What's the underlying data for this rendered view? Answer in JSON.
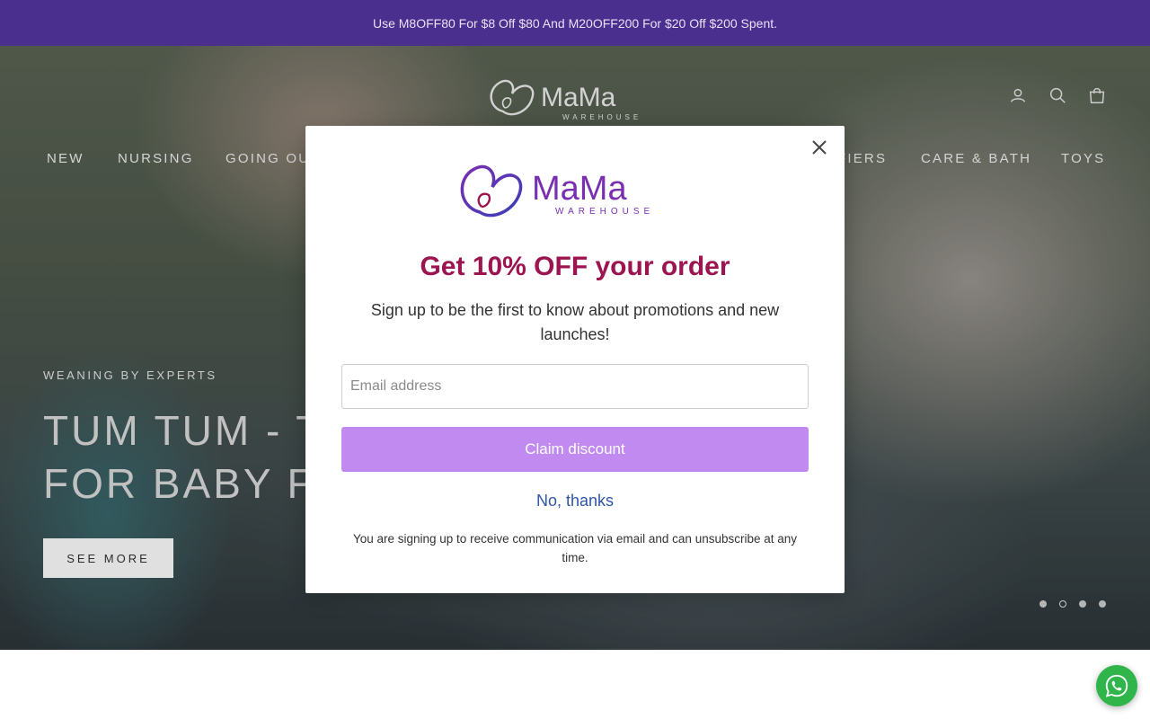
{
  "announcement": {
    "text": "Use M8OFF80 For $8 Off $80 And M20OFF200 For $20 Off $200 Spent."
  },
  "header": {
    "logo": {
      "word": "MaMa",
      "sub": "WAREHOUSE"
    },
    "icons": [
      "account-icon",
      "search-icon",
      "cart-icon"
    ]
  },
  "nav": {
    "items": [
      {
        "label": "NEW"
      },
      {
        "label": "NURSING"
      },
      {
        "label": "GOING OU"
      },
      {
        "label": "FIERS"
      },
      {
        "label": "CARE & BATH"
      },
      {
        "label": "TOYS"
      }
    ]
  },
  "hero": {
    "eyebrow": "WEANING BY EXPERTS",
    "title_line1": "TUM TUM - T",
    "title_line2": "FOR BABY F",
    "cta": "SEE MORE",
    "slides": 4,
    "active_slide": 2
  },
  "popup": {
    "logo": {
      "word": "MaMa",
      "sub": "WAREHOUSE"
    },
    "heading": "Get 10% OFF your order",
    "subtext": "Sign up to be the first to know about promotions and new launches!",
    "email_placeholder": "Email address",
    "claim_label": "Claim discount",
    "decline_label": "No, thanks",
    "fineprint": "You are signing up to receive communication via email and can unsubscribe at any time."
  },
  "colors": {
    "announcement_bg": "#4b2f8f",
    "heading": "#9c1550",
    "claim_button": "#c18af0",
    "link": "#2f56a6",
    "whatsapp": "#2fb54a"
  }
}
